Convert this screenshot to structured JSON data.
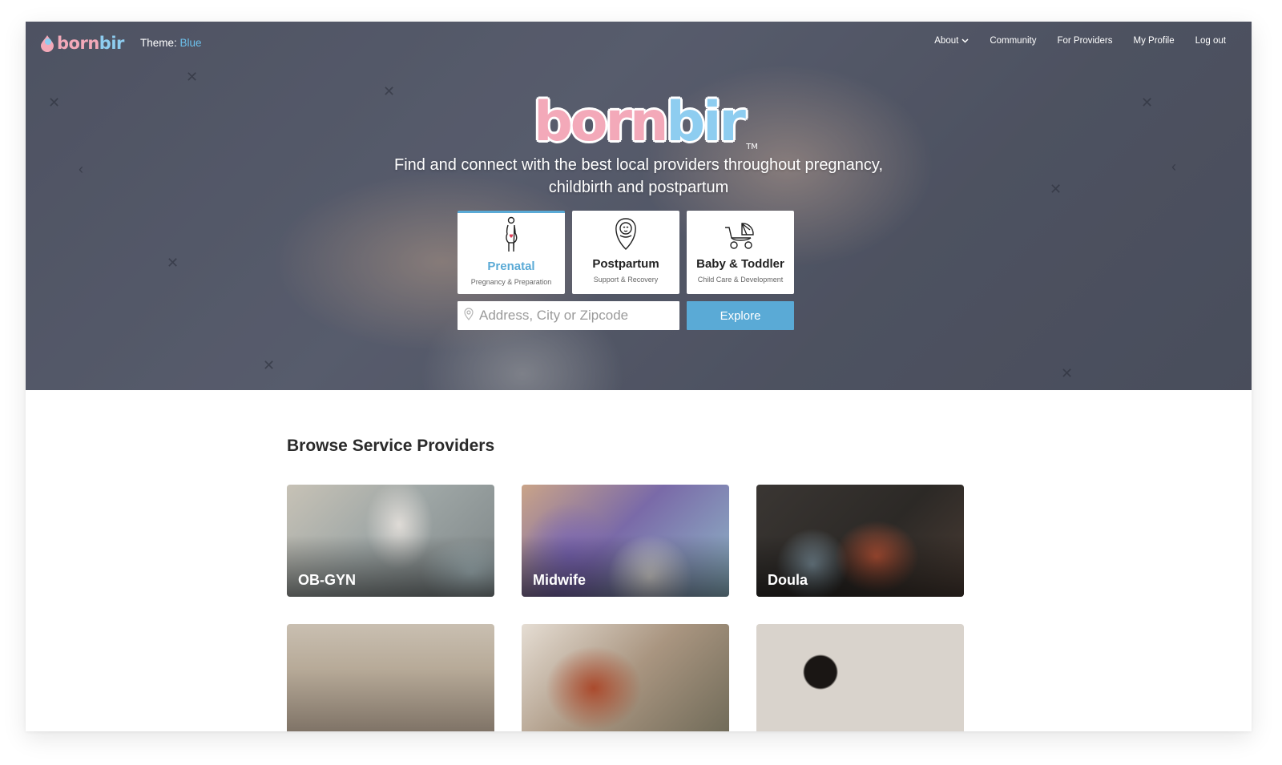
{
  "header": {
    "logo_text_pink": "born",
    "logo_text_blue": "bir",
    "theme_label": "Theme:",
    "theme_value": "Blue",
    "nav": [
      {
        "label": "About",
        "has_dropdown": true
      },
      {
        "label": "Community"
      },
      {
        "label": "For Providers"
      },
      {
        "label": "My Profile"
      },
      {
        "label": "Log out"
      }
    ]
  },
  "hero": {
    "brand_pink": "born",
    "brand_blue": "bir",
    "trademark": "TM",
    "tagline_line1": "Find and connect with the best local providers throughout pregnancy,",
    "tagline_line2": "childbirth and postpartum",
    "tabs": [
      {
        "label": "Prenatal",
        "sub": "Pregnancy & Preparation",
        "icon": "pregnant-woman-icon",
        "active": true
      },
      {
        "label": "Postpartum",
        "sub": "Support & Recovery",
        "icon": "swaddled-baby-icon",
        "active": false
      },
      {
        "label": "Baby & Toddler",
        "sub": "Child Care & Development",
        "icon": "stroller-icon",
        "active": false
      }
    ],
    "search": {
      "placeholder": "Address, City or Zipcode",
      "value": "",
      "button_label": "Explore"
    }
  },
  "browse": {
    "title": "Browse Service Providers",
    "cards": [
      {
        "label": "OB-GYN"
      },
      {
        "label": "Midwife"
      },
      {
        "label": "Doula"
      },
      {
        "label": ""
      },
      {
        "label": ""
      },
      {
        "label": ""
      }
    ]
  },
  "colors": {
    "accent_blue": "#5aaad6",
    "brand_pink": "#f3a9b9",
    "brand_blue": "#8ecdf0"
  }
}
